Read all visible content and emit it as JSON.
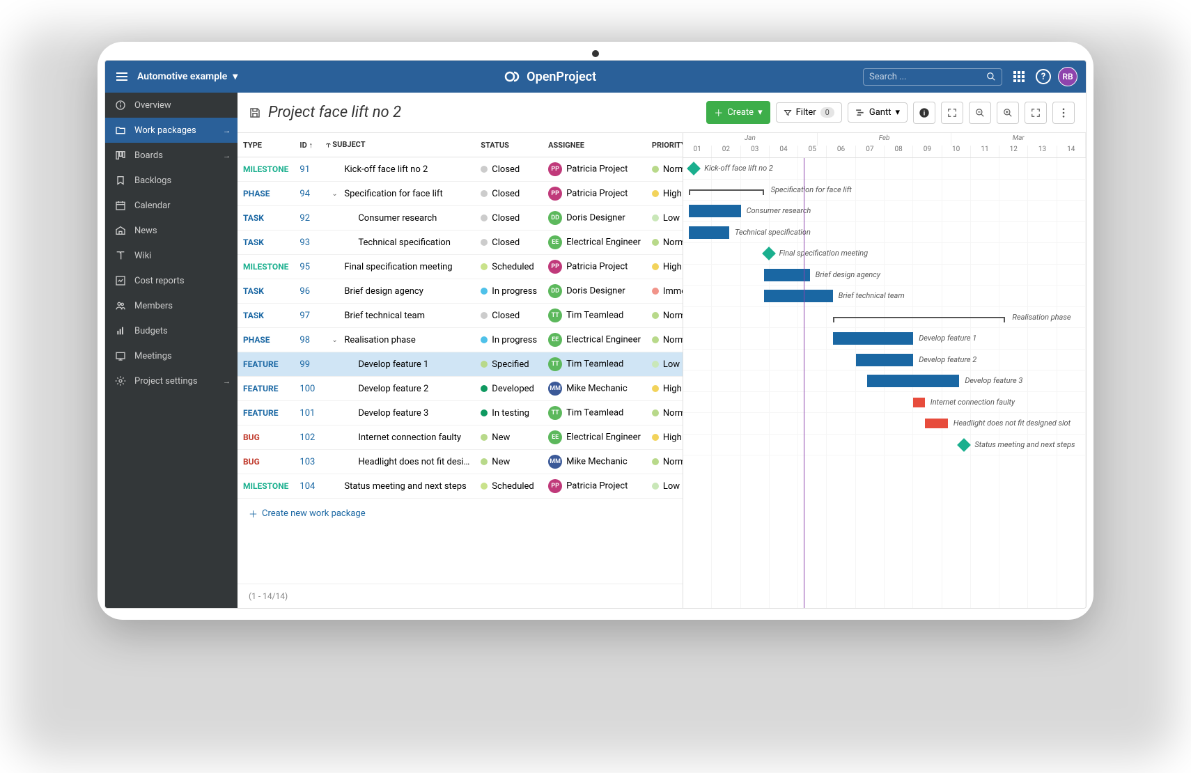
{
  "topbar": {
    "project_name": "Automotive example",
    "app_name": "OpenProject",
    "search_placeholder": "Search ...",
    "user_initials": "RB"
  },
  "sidebar": {
    "items": [
      {
        "label": "Overview",
        "icon": "info"
      },
      {
        "label": "Work packages",
        "icon": "folder",
        "active": true,
        "arrow": true
      },
      {
        "label": "Boards",
        "icon": "boards",
        "arrow": true
      },
      {
        "label": "Backlogs",
        "icon": "backlogs"
      },
      {
        "label": "Calendar",
        "icon": "calendar"
      },
      {
        "label": "News",
        "icon": "news"
      },
      {
        "label": "Wiki",
        "icon": "wiki"
      },
      {
        "label": "Cost reports",
        "icon": "cost"
      },
      {
        "label": "Members",
        "icon": "members"
      },
      {
        "label": "Budgets",
        "icon": "budgets"
      },
      {
        "label": "Meetings",
        "icon": "meetings"
      },
      {
        "label": "Project settings",
        "icon": "settings",
        "arrow": true
      }
    ]
  },
  "toolbar": {
    "page_title": "Project face lift no 2",
    "create_label": "Create",
    "filter_label": "Filter",
    "filter_count": "0",
    "gantt_label": "Gantt"
  },
  "columns": {
    "type": "TYPE",
    "id": "ID",
    "subject": "SUBJECT",
    "status": "STATUS",
    "assignee": "ASSIGNEE",
    "priority": "PRIORITY"
  },
  "rows": [
    {
      "type": "MILESTONE",
      "id": "91",
      "subject": "Kick-off face lift no 2",
      "indent": 0,
      "status": "Closed",
      "status_color": "#ccc",
      "assignee": "Patricia Project",
      "badge": "PP",
      "badge_color": "#c0397a",
      "priority": "Normal",
      "prio_color": "#b8d98a",
      "gantt": {
        "kind": "diamond",
        "start": 1,
        "label": "Kick-off face lift no 2"
      }
    },
    {
      "type": "PHASE",
      "id": "94",
      "subject": "Specification for face lift",
      "indent": 0,
      "caret": true,
      "status": "Closed",
      "status_color": "#ccc",
      "assignee": "Patricia Project",
      "badge": "PP",
      "badge_color": "#c0397a",
      "priority": "High",
      "prio_color": "#f2d35b",
      "gantt": {
        "kind": "bracket",
        "start": 1,
        "end": 14,
        "label": "Specification for face lift"
      }
    },
    {
      "type": "TASK",
      "id": "92",
      "subject": "Consumer research",
      "indent": 1,
      "status": "Closed",
      "status_color": "#ccc",
      "assignee": "Doris Designer",
      "badge": "DD",
      "badge_color": "#5cb85c",
      "priority": "Low",
      "prio_color": "#c9e7b8",
      "gantt": {
        "kind": "bar",
        "start": 1,
        "end": 10,
        "label": "Consumer research"
      }
    },
    {
      "type": "TASK",
      "id": "93",
      "subject": "Technical specification",
      "indent": 1,
      "status": "Closed",
      "status_color": "#ccc",
      "assignee": "Electrical Engineer",
      "badge": "EE",
      "badge_color": "#5cb85c",
      "priority": "Normal",
      "prio_color": "#b8d98a",
      "gantt": {
        "kind": "bar",
        "start": 1,
        "end": 8,
        "label": "Technical specification"
      }
    },
    {
      "type": "MILESTONE",
      "id": "95",
      "subject": "Final specification meeting",
      "indent": 0,
      "status": "Scheduled",
      "status_color": "#c9e28b",
      "assignee": "Patricia Project",
      "badge": "PP",
      "badge_color": "#c0397a",
      "priority": "High",
      "prio_color": "#f2d35b",
      "gantt": {
        "kind": "diamond",
        "start": 14,
        "label": "Final specification meeting"
      }
    },
    {
      "type": "TASK",
      "id": "96",
      "subject": "Brief design agency",
      "indent": 0,
      "status": "In progress",
      "status_color": "#4fc1e9",
      "assignee": "Doris Designer",
      "badge": "DD",
      "badge_color": "#5cb85c",
      "priority": "Immediate",
      "prio_color": "#f1948a",
      "gantt": {
        "kind": "bar",
        "start": 14,
        "end": 22,
        "label": "Brief design agency"
      }
    },
    {
      "type": "TASK",
      "id": "97",
      "subject": "Brief technical team",
      "indent": 0,
      "status": "Closed",
      "status_color": "#ccc",
      "assignee": "Tim Teamlead",
      "badge": "TT",
      "badge_color": "#5cb85c",
      "priority": "Normal",
      "prio_color": "#b8d98a",
      "gantt": {
        "kind": "bar",
        "start": 14,
        "end": 26,
        "label": "Brief technical team"
      }
    },
    {
      "type": "PHASE",
      "id": "98",
      "subject": "Realisation phase",
      "indent": 0,
      "caret": true,
      "status": "In progress",
      "status_color": "#4fc1e9",
      "assignee": "Electrical Engineer",
      "badge": "EE",
      "badge_color": "#5cb85c",
      "priority": "Normal",
      "prio_color": "#b8d98a",
      "gantt": {
        "kind": "bracket",
        "start": 26,
        "end": 56,
        "label": "Realisation phase"
      }
    },
    {
      "type": "FEATURE",
      "id": "99",
      "subject": "Develop feature 1",
      "indent": 1,
      "status": "Specified",
      "status_color": "#b8d98a",
      "assignee": "Tim Teamlead",
      "badge": "TT",
      "badge_color": "#5cb85c",
      "priority": "Low",
      "prio_color": "#c9e7b8",
      "selected": true,
      "gantt": {
        "kind": "bar",
        "start": 26,
        "end": 40,
        "label": "Develop feature 1"
      }
    },
    {
      "type": "FEATURE",
      "id": "100",
      "subject": "Develop feature 2",
      "indent": 1,
      "status": "Developed",
      "status_color": "#0f9960",
      "assignee": "Mike Mechanic",
      "badge": "MM",
      "badge_color": "#3b5998",
      "priority": "High",
      "prio_color": "#f2d35b",
      "gantt": {
        "kind": "bar",
        "start": 30,
        "end": 40,
        "label": "Develop feature 2"
      }
    },
    {
      "type": "FEATURE",
      "id": "101",
      "subject": "Develop feature 3",
      "indent": 1,
      "status": "In testing",
      "status_color": "#0f9960",
      "assignee": "Tim Teamlead",
      "badge": "TT",
      "badge_color": "#5cb85c",
      "priority": "Normal",
      "prio_color": "#b8d98a",
      "gantt": {
        "kind": "bar",
        "start": 32,
        "end": 48,
        "label": "Develop feature 3"
      }
    },
    {
      "type": "BUG",
      "id": "102",
      "subject": "Internet connection faulty",
      "indent": 1,
      "status": "New",
      "status_color": "#b8d98a",
      "assignee": "Electrical Engineer",
      "badge": "EE",
      "badge_color": "#5cb85c",
      "priority": "High",
      "prio_color": "#f2d35b",
      "gantt": {
        "kind": "bug",
        "start": 40,
        "end": 42,
        "label": "Internet connection faulty"
      }
    },
    {
      "type": "BUG",
      "id": "103",
      "subject": "Headlight does not fit desi…",
      "indent": 1,
      "status": "New",
      "status_color": "#b8d98a",
      "assignee": "Mike Mechanic",
      "badge": "MM",
      "badge_color": "#3b5998",
      "priority": "Normal",
      "prio_color": "#b8d98a",
      "gantt": {
        "kind": "bug",
        "start": 42,
        "end": 46,
        "label": "Headlight does not fit designed slot"
      }
    },
    {
      "type": "MILESTONE",
      "id": "104",
      "subject": "Status meeting and next steps",
      "indent": 0,
      "status": "Scheduled",
      "status_color": "#c9e28b",
      "assignee": "Patricia Project",
      "badge": "PP",
      "badge_color": "#c0397a",
      "priority": "Low",
      "prio_color": "#c9e7b8",
      "gantt": {
        "kind": "diamond",
        "start": 48,
        "label": "Status meeting and next steps"
      }
    }
  ],
  "add_row_label": "Create new work package",
  "pager": "(1 - 14/14)",
  "gantt": {
    "months": [
      "Jan",
      "Feb",
      "Mar"
    ],
    "days": [
      "01",
      "02",
      "03",
      "04",
      "05",
      "06",
      "07",
      "08",
      "09",
      "10",
      "11",
      "12",
      "13",
      "14"
    ],
    "today_pct": 30,
    "scale": 70
  }
}
